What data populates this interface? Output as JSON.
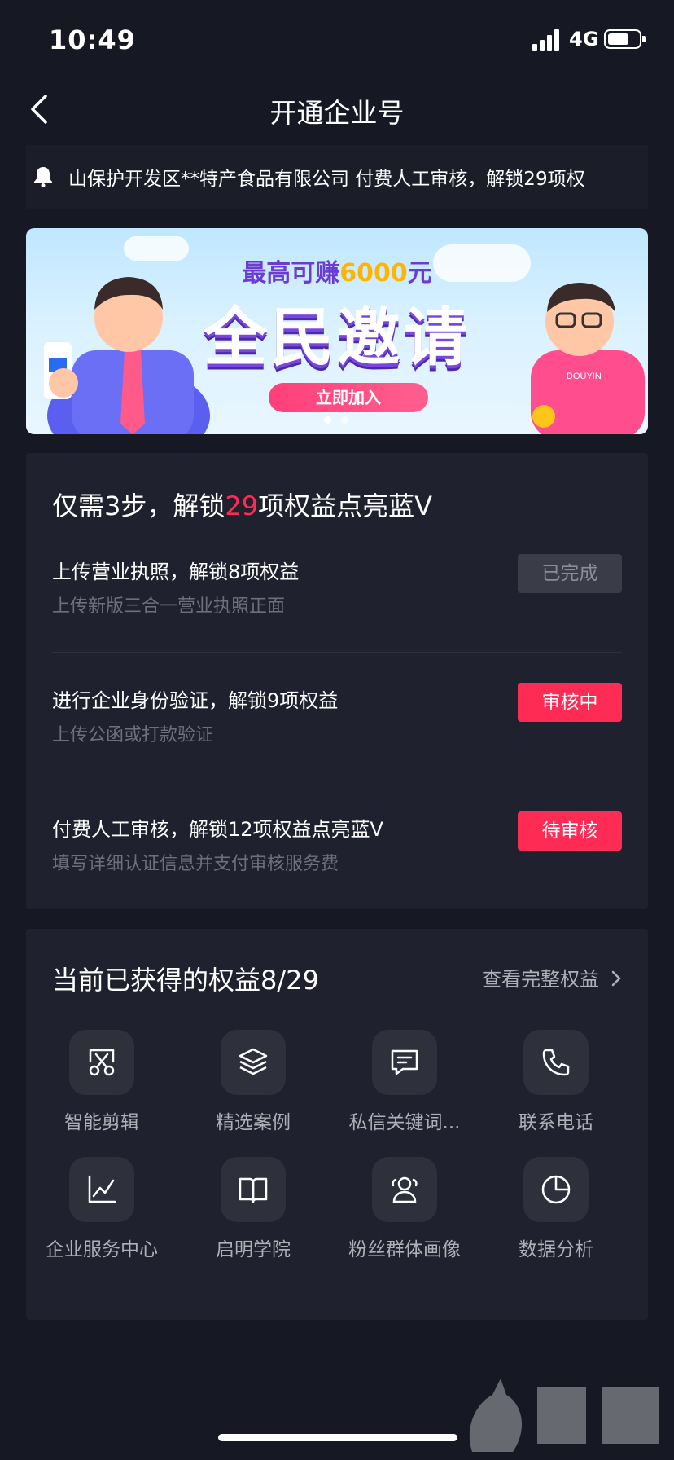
{
  "status_bar": {
    "time": "10:49",
    "network": "4G",
    "battery_level": 0.7
  },
  "nav": {
    "title": "开通企业号"
  },
  "notice": {
    "text": "山保护开发区**特产食品有限公司 付费人工审核，解锁29项权"
  },
  "banner": {
    "subtitle_prefix": "最高可赚",
    "subtitle_amount": "6000",
    "subtitle_suffix": "元",
    "headline": "全民邀请",
    "button_label": "立即加入",
    "shirt_text": "DOUYIN",
    "page_count": 2,
    "active_page": 1
  },
  "steps": {
    "title_prefix": "仅需3步，解锁",
    "title_highlight": "29",
    "title_suffix": "项权益点亮蓝V",
    "accent_color": "#fe2c55",
    "items": [
      {
        "title": "上传营业执照，解锁8项权益",
        "desc": "上传新版三合一营业执照正面",
        "status": "已完成",
        "status_type": "done"
      },
      {
        "title": "进行企业身份验证，解锁9项权益",
        "desc": "上传公函或打款验证",
        "status": "审核中",
        "status_type": "pending"
      },
      {
        "title": "付费人工审核，解锁12项权益点亮蓝V",
        "desc": "填写详细认证信息并支付审核服务费",
        "status": "待审核",
        "status_type": "pending"
      }
    ]
  },
  "benefits": {
    "title": "当前已获得的权益8/29",
    "link_label": "查看完整权益",
    "items": [
      {
        "label": "智能剪辑",
        "icon": "scissors-icon"
      },
      {
        "label": "精选案例",
        "icon": "layers-icon"
      },
      {
        "label": "私信关键词...",
        "icon": "message-icon"
      },
      {
        "label": "联系电话",
        "icon": "phone-icon"
      },
      {
        "label": "企业服务中心",
        "icon": "chart-line-icon"
      },
      {
        "label": "启明学院",
        "icon": "book-icon"
      },
      {
        "label": "粉丝群体画像",
        "icon": "users-icon"
      },
      {
        "label": "数据分析",
        "icon": "pie-chart-icon"
      }
    ]
  }
}
